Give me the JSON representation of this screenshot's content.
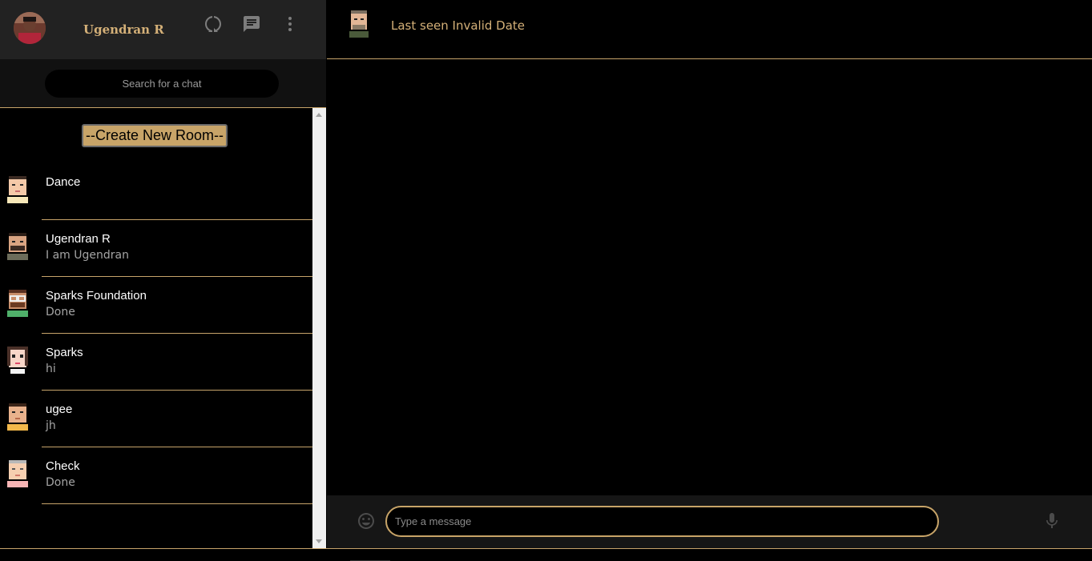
{
  "sidebar": {
    "user_name": "Ugendran R",
    "icons": [
      "status-icon",
      "chat-icon",
      "more-vert-icon"
    ],
    "search": {
      "placeholder": "Search for a chat"
    },
    "create_room_label": "--Create New Room--",
    "chats": [
      {
        "name": "Dance",
        "last_message": ""
      },
      {
        "name": "Ugendran R",
        "last_message": "I am Ugendran"
      },
      {
        "name": "Sparks Foundation",
        "last_message": "Done"
      },
      {
        "name": "Sparks",
        "last_message": "hi"
      },
      {
        "name": "ugee",
        "last_message": "jh"
      },
      {
        "name": "Check",
        "last_message": "Done"
      }
    ]
  },
  "chat": {
    "last_seen": "Last seen Invalid Date",
    "input": {
      "placeholder": "Type a message"
    }
  },
  "colors": {
    "accent": "#c8a468",
    "header_bg": "#222222",
    "background": "#000000"
  }
}
